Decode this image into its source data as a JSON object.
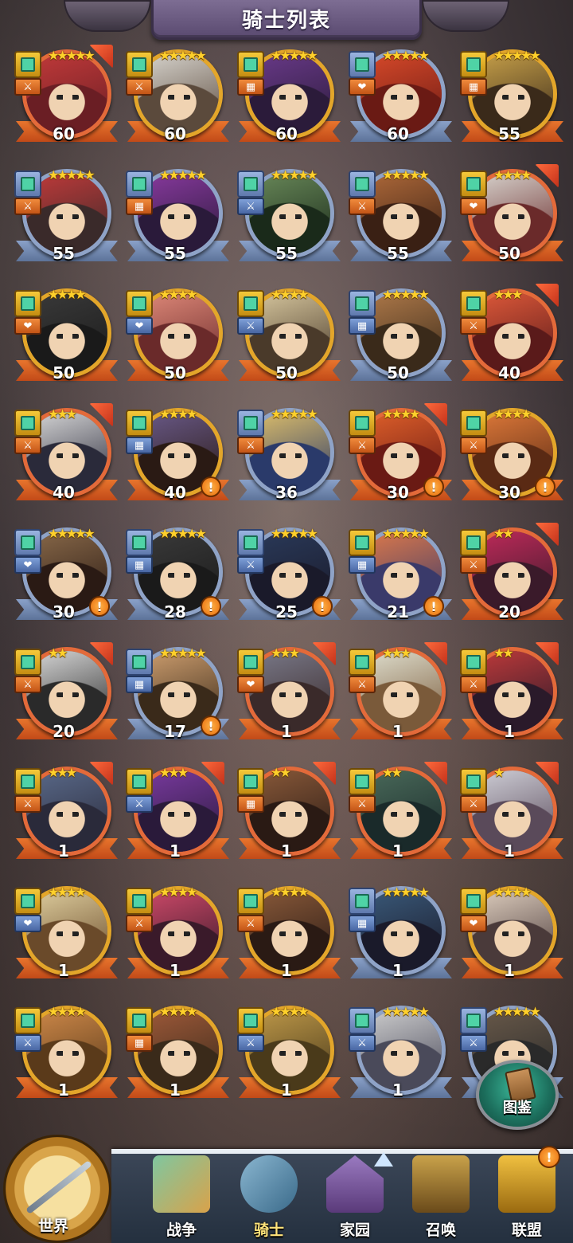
{
  "header": {
    "title": "骑士列表"
  },
  "knights": [
    {
      "level": "60",
      "stars": 5,
      "frame": "red",
      "badge": "gold",
      "role": "⚔",
      "role_color": "red",
      "arrow": true,
      "alert": false,
      "c1": "#c23a3a",
      "c2": "#6a1e24"
    },
    {
      "level": "60",
      "stars": 5,
      "frame": "gold",
      "badge": "gold",
      "role": "⚔",
      "role_color": "red",
      "arrow": false,
      "alert": false,
      "c1": "#d9d6d0",
      "c2": "#5b4a3c"
    },
    {
      "level": "60",
      "stars": 5,
      "frame": "gold",
      "badge": "gold",
      "role": "▦",
      "role_color": "red",
      "arrow": false,
      "alert": false,
      "c1": "#6a3a8a",
      "c2": "#2b1b3a"
    },
    {
      "level": "60",
      "stars": 5,
      "frame": "blue",
      "badge": "blue",
      "role": "❤",
      "role_color": "red",
      "arrow": false,
      "alert": false,
      "c1": "#d94a2a",
      "c2": "#6a1a14"
    },
    {
      "level": "55",
      "stars": 5,
      "frame": "gold",
      "badge": "gold",
      "role": "▦",
      "role_color": "red",
      "arrow": false,
      "alert": false,
      "c1": "#c9a24a",
      "c2": "#3a2a1a"
    },
    {
      "level": "55",
      "stars": 5,
      "frame": "blue",
      "badge": "blue",
      "role": "⚔",
      "role_color": "red",
      "arrow": false,
      "alert": false,
      "c1": "#c23a3a",
      "c2": "#3a2a2a"
    },
    {
      "level": "55",
      "stars": 5,
      "frame": "blue",
      "badge": "blue",
      "role": "▦",
      "role_color": "red",
      "arrow": false,
      "alert": false,
      "c1": "#8a3aa0",
      "c2": "#2a1a3a"
    },
    {
      "level": "55",
      "stars": 5,
      "frame": "blue",
      "badge": "blue",
      "role": "⚔",
      "role_color": "blue",
      "arrow": false,
      "alert": false,
      "c1": "#6a8a5a",
      "c2": "#1a2a1a"
    },
    {
      "level": "55",
      "stars": 5,
      "frame": "blue",
      "badge": "blue",
      "role": "⚔",
      "role_color": "red",
      "arrow": false,
      "alert": false,
      "c1": "#b06a3a",
      "c2": "#3a2014"
    },
    {
      "level": "50",
      "stars": 4,
      "frame": "red",
      "badge": "gold",
      "role": "❤",
      "role_color": "red",
      "arrow": true,
      "alert": false,
      "c1": "#d9d6d0",
      "c2": "#6a2a2a"
    },
    {
      "level": "50",
      "stars": 4,
      "frame": "gold",
      "badge": "gold",
      "role": "❤",
      "role_color": "red",
      "arrow": false,
      "alert": false,
      "c1": "#3a3a3a",
      "c2": "#1a1a1a"
    },
    {
      "level": "50",
      "stars": 4,
      "frame": "gold",
      "badge": "gold",
      "role": "❤",
      "role_color": "blue",
      "arrow": false,
      "alert": false,
      "c1": "#e08a7a",
      "c2": "#6a2a2a"
    },
    {
      "level": "50",
      "stars": 4,
      "frame": "gold",
      "badge": "gold",
      "role": "⚔",
      "role_color": "blue",
      "arrow": false,
      "alert": false,
      "c1": "#d9c9a0",
      "c2": "#4a3a2a"
    },
    {
      "level": "50",
      "stars": 5,
      "frame": "blue",
      "badge": "blue",
      "role": "▦",
      "role_color": "blue",
      "arrow": false,
      "alert": false,
      "c1": "#b07a4a",
      "c2": "#3a2a1a"
    },
    {
      "level": "40",
      "stars": 3,
      "frame": "red",
      "badge": "gold",
      "role": "⚔",
      "role_color": "red",
      "arrow": true,
      "alert": false,
      "c1": "#e05a3a",
      "c2": "#5a1a1a"
    },
    {
      "level": "40",
      "stars": 3,
      "frame": "red",
      "badge": "gold",
      "role": "⚔",
      "role_color": "red",
      "arrow": true,
      "alert": false,
      "c1": "#d9d9d9",
      "c2": "#2a2a3a"
    },
    {
      "level": "40",
      "stars": 4,
      "frame": "gold",
      "badge": "gold",
      "role": "▦",
      "role_color": "blue",
      "arrow": false,
      "alert": true,
      "c1": "#6a5a8a",
      "c2": "#2a1a14"
    },
    {
      "level": "36",
      "stars": 5,
      "frame": "blue",
      "badge": "blue",
      "role": "⚔",
      "role_color": "red",
      "arrow": false,
      "alert": false,
      "c1": "#e0c06a",
      "c2": "#2a3a6a"
    },
    {
      "level": "30",
      "stars": 4,
      "frame": "red",
      "badge": "gold",
      "role": "⚔",
      "role_color": "red",
      "arrow": true,
      "alert": true,
      "c1": "#e0602a",
      "c2": "#6a1a14"
    },
    {
      "level": "30",
      "stars": 4,
      "frame": "gold",
      "badge": "gold",
      "role": "⚔",
      "role_color": "red",
      "arrow": false,
      "alert": true,
      "c1": "#e07a3a",
      "c2": "#5a2a14"
    },
    {
      "level": "30",
      "stars": 5,
      "frame": "blue",
      "badge": "blue",
      "role": "❤",
      "role_color": "blue",
      "arrow": false,
      "alert": true,
      "c1": "#8a6a4a",
      "c2": "#2a1a14"
    },
    {
      "level": "28",
      "stars": 5,
      "frame": "blue",
      "badge": "blue",
      "role": "▦",
      "role_color": "blue",
      "arrow": false,
      "alert": true,
      "c1": "#3a3a3a",
      "c2": "#1a1a1a"
    },
    {
      "level": "25",
      "stars": 5,
      "frame": "blue",
      "badge": "blue",
      "role": "⚔",
      "role_color": "blue",
      "arrow": false,
      "alert": true,
      "c1": "#2a3a5a",
      "c2": "#1a1a2a"
    },
    {
      "level": "21",
      "stars": 5,
      "frame": "blue",
      "badge": "gold",
      "role": "▦",
      "role_color": "blue",
      "arrow": false,
      "alert": true,
      "c1": "#e07a4a",
      "c2": "#3a3a6a"
    },
    {
      "level": "20",
      "stars": 2,
      "frame": "red",
      "badge": "gold",
      "role": "⚔",
      "role_color": "red",
      "arrow": true,
      "alert": false,
      "c1": "#c02a5a",
      "c2": "#3a1a2a"
    },
    {
      "level": "20",
      "stars": 2,
      "frame": "red",
      "badge": "gold",
      "role": "⚔",
      "role_color": "red",
      "arrow": true,
      "alert": false,
      "c1": "#d9d9d9",
      "c2": "#2a2a2a"
    },
    {
      "level": "17",
      "stars": 5,
      "frame": "blue",
      "badge": "blue",
      "role": "▦",
      "role_color": "blue",
      "arrow": false,
      "alert": true,
      "c1": "#d0a070",
      "c2": "#3a2a1a"
    },
    {
      "level": "1",
      "stars": 3,
      "frame": "red",
      "badge": "gold",
      "role": "❤",
      "role_color": "red",
      "arrow": true,
      "alert": false,
      "c1": "#7a7a8a",
      "c2": "#3a2a2a"
    },
    {
      "level": "1",
      "stars": 3,
      "frame": "red",
      "badge": "gold",
      "role": "⚔",
      "role_color": "red",
      "arrow": true,
      "alert": false,
      "c1": "#e0e0d0",
      "c2": "#7a5a3a"
    },
    {
      "level": "1",
      "stars": 2,
      "frame": "red",
      "badge": "gold",
      "role": "⚔",
      "role_color": "red",
      "arrow": true,
      "alert": false,
      "c1": "#c03a3a",
      "c2": "#2a1a2a"
    },
    {
      "level": "1",
      "stars": 3,
      "frame": "red",
      "badge": "gold",
      "role": "⚔",
      "role_color": "red",
      "arrow": true,
      "alert": false,
      "c1": "#5a6a8a",
      "c2": "#2a2a3a"
    },
    {
      "level": "1",
      "stars": 3,
      "frame": "red",
      "badge": "gold",
      "role": "⚔",
      "role_color": "blue",
      "arrow": true,
      "alert": false,
      "c1": "#7a3aa0",
      "c2": "#2a1a3a"
    },
    {
      "level": "1",
      "stars": 2,
      "frame": "red",
      "badge": "gold",
      "role": "▦",
      "role_color": "red",
      "arrow": true,
      "alert": false,
      "c1": "#8a5a3a",
      "c2": "#2a1a14"
    },
    {
      "level": "1",
      "stars": 2,
      "frame": "red",
      "badge": "gold",
      "role": "⚔",
      "role_color": "red",
      "arrow": true,
      "alert": false,
      "c1": "#4a6a5a",
      "c2": "#1a2a2a"
    },
    {
      "level": "1",
      "stars": 1,
      "frame": "red",
      "badge": "gold",
      "role": "⚔",
      "role_color": "red",
      "arrow": true,
      "alert": false,
      "c1": "#d0d0d8",
      "c2": "#5a4a5a"
    },
    {
      "level": "1",
      "stars": 4,
      "frame": "gold",
      "badge": "gold",
      "role": "❤",
      "role_color": "blue",
      "arrow": false,
      "alert": false,
      "c1": "#e0d0a0",
      "c2": "#6a4a2a"
    },
    {
      "level": "1",
      "stars": 4,
      "frame": "gold",
      "badge": "gold",
      "role": "⚔",
      "role_color": "red",
      "arrow": false,
      "alert": false,
      "c1": "#d04a6a",
      "c2": "#3a1a2a"
    },
    {
      "level": "1",
      "stars": 4,
      "frame": "gold",
      "badge": "gold",
      "role": "⚔",
      "role_color": "red",
      "arrow": false,
      "alert": false,
      "c1": "#8a5a3a",
      "c2": "#2a1a14"
    },
    {
      "level": "1",
      "stars": 5,
      "frame": "blue",
      "badge": "blue",
      "role": "▦",
      "role_color": "blue",
      "arrow": false,
      "alert": false,
      "c1": "#3a5a7a",
      "c2": "#1a1a2a"
    },
    {
      "level": "1",
      "stars": 4,
      "frame": "gold",
      "badge": "gold",
      "role": "❤",
      "role_color": "red",
      "arrow": false,
      "alert": false,
      "c1": "#e0d0c0",
      "c2": "#4a3a3a"
    },
    {
      "level": "1",
      "stars": 4,
      "frame": "gold",
      "badge": "gold",
      "role": "⚔",
      "role_color": "blue",
      "arrow": false,
      "alert": false,
      "c1": "#d08a4a",
      "c2": "#5a3a1a"
    },
    {
      "level": "1",
      "stars": 4,
      "frame": "gold",
      "badge": "gold",
      "role": "▦",
      "role_color": "red",
      "arrow": false,
      "alert": false,
      "c1": "#a05a3a",
      "c2": "#3a2a1a"
    },
    {
      "level": "1",
      "stars": 4,
      "frame": "gold",
      "badge": "gold",
      "role": "⚔",
      "role_color": "blue",
      "arrow": false,
      "alert": false,
      "c1": "#c09a4a",
      "c2": "#4a3a1a"
    },
    {
      "level": "1",
      "stars": 5,
      "frame": "blue",
      "badge": "blue",
      "role": "⚔",
      "role_color": "blue",
      "arrow": false,
      "alert": false,
      "c1": "#d0d0d0",
      "c2": "#4a4a5a"
    },
    {
      "level": "",
      "stars": 5,
      "frame": "blue",
      "badge": "blue",
      "role": "⚔",
      "role_color": "blue",
      "arrow": false,
      "alert": false,
      "c1": "#6a5a4a",
      "c2": "#2a2a2a"
    }
  ],
  "encyclopedia": {
    "label": "图鉴"
  },
  "nav": {
    "world": "世界",
    "war": "战争",
    "knight": "骑士",
    "home": "家园",
    "summon": "召唤",
    "alliance": "联盟",
    "alliance_badge": "!"
  },
  "colors": {
    "gold_frame": "#e3a62a",
    "blue_frame": "#8fa3c7",
    "red_frame": "#e36a3a",
    "star": "#ffd02b",
    "alert": "#e86a0b"
  }
}
